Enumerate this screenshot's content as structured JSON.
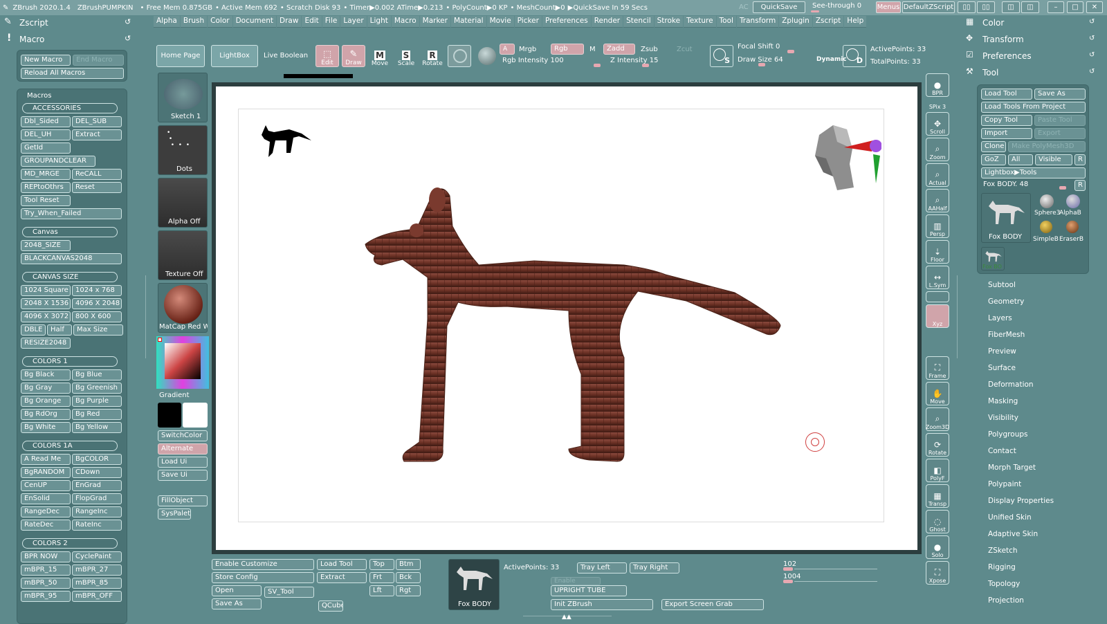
{
  "topbar": {
    "title": "ZBrush 2020.1.4",
    "doc": "ZBrushPUMPKIN",
    "free_mem": "• Free Mem 0.875GB",
    "active_mem": "• Active Mem 692",
    "scratch": "• Scratch Disk 93",
    "timer": "• Timer▶0.002 ATime▶0.213",
    "polycount": "• PolyCount▶0 KP",
    "meshcount": "• MeshCount▶0",
    "quicksave_in": "▶QuickSave In 59 Secs",
    "ac": "AC",
    "quicksave": "QuickSave",
    "seethrough": "See-through  0",
    "menus": "Menus",
    "script": "DefaultZScript"
  },
  "menus": [
    "Alpha",
    "Brush",
    "Color",
    "Document",
    "Draw",
    "Edit",
    "File",
    "Layer",
    "Light",
    "Macro",
    "Marker",
    "Material",
    "Movie",
    "Picker",
    "Preferences",
    "Render",
    "Stencil",
    "Stroke",
    "Texture",
    "Tool",
    "Transform",
    "Zplugin",
    "Zscript",
    "Help"
  ],
  "left": {
    "zscript": "Zscript",
    "macro": "Macro",
    "new_macro": "New Macro",
    "end_macro": "End Macro",
    "reload": "Reload All Macros",
    "macros": "Macros",
    "sections": [
      {
        "title": "ACCESSORIES",
        "rows": [
          [
            "Dbl_Sided",
            "DEL_SUB"
          ],
          [
            "DEL_UH",
            "Extract"
          ],
          [
            "GetId"
          ],
          [
            "GROUPANDCLEAR"
          ],
          [
            "MD_MRGE",
            "ReCALL"
          ],
          [
            "REPtoOthrs",
            "Reset"
          ],
          [
            "Tool Reset"
          ],
          [
            "Try_When_Failed"
          ]
        ]
      },
      {
        "title": "Canvas",
        "rows": [
          [
            "2048_SIZE"
          ],
          [
            "BLACKCANVAS2048"
          ]
        ]
      },
      {
        "title": "CANVAS SIZE",
        "rows": [
          [
            "1024 Square",
            "1024 x 768"
          ],
          [
            "2048 X 1536",
            "4096 X 2048"
          ],
          [
            "4096 X 3072",
            "800 X 600"
          ],
          [
            "DBLE",
            "Half",
            "Max Size"
          ],
          [
            "RESIZE2048"
          ]
        ]
      },
      {
        "title": "COLORS 1",
        "rows": [
          [
            "Bg Black",
            "Bg Blue"
          ],
          [
            "Bg Gray",
            "Bg Greenish"
          ],
          [
            "Bg Orange",
            "Bg Purple"
          ],
          [
            "Bg RdOrg",
            "Bg Red"
          ],
          [
            "Bg White",
            "Bg Yellow"
          ]
        ]
      },
      {
        "title": "COLORS 1A",
        "rows": [
          [
            "A Read Me",
            "BgCOLOR"
          ],
          [
            "BgRANDOM",
            "CDown"
          ],
          [
            "CenUP",
            "EnGrad"
          ],
          [
            "EnSolid",
            "FlopGrad"
          ],
          [
            "RangeDec",
            "RangeInc"
          ],
          [
            "RateDec",
            "RateInc"
          ]
        ]
      },
      {
        "title": "COLORS 2",
        "rows": [
          [
            "BPR NOW",
            "CyclePaint"
          ],
          [
            "mBPR_15",
            "mBPR_27"
          ],
          [
            "mBPR_50",
            "mBPR_85"
          ],
          [
            "mBPR_95",
            "mBPR_OFF"
          ]
        ]
      }
    ]
  },
  "shelf": {
    "home": "Home Page",
    "lightbox": "LightBox",
    "live_boolean": "Live Boolean",
    "edit": "Edit",
    "draw": "Draw",
    "move": "Move",
    "scale": "Scale",
    "rotate": "Rotate",
    "a": "A",
    "mrgb": "Mrgb",
    "rgb": "Rgb",
    "m": "M",
    "zadd": "Zadd",
    "zsub": "Zsub",
    "zcut": "Zcut",
    "rgb_intensity": "Rgb Intensity 100",
    "z_intensity": "Z Intensity 15",
    "focal_shift": "Focal Shift 0",
    "draw_size": "Draw Size 64",
    "dynamic": "Dynamic",
    "active_points": "ActivePoints: 33",
    "total_points": "TotalPoints: 33"
  },
  "brushes": {
    "stroke": "Sketch 1",
    "dots": "Dots",
    "alpha": "Alpha Off",
    "texture": "Texture Off",
    "material": "MatCap Red Wa",
    "gradient": "Gradient",
    "switch_color": "SwitchColor",
    "alternate": "Alternate",
    "load_ui": "Load Ui",
    "save_ui": "Save Ui",
    "fill_object": "FillObject",
    "sys_palette": "SysPalett"
  },
  "right_tools": [
    "BPR",
    "SPix 3",
    "Scroll",
    "Zoom",
    "Actual",
    "AAHalf",
    "Persp",
    "Floor",
    "L.Sym",
    "",
    "Xyz",
    "",
    "",
    "Frame",
    "Move",
    "Zoom3D",
    "Rotate",
    "PolyF",
    "Transp",
    "Ghost",
    "Solo",
    "Xpose"
  ],
  "tool_panel": {
    "color": "Color",
    "transform": "Transform",
    "preferences": "Preferences",
    "tool": "Tool",
    "load_tool": "Load Tool",
    "save_as": "Save As",
    "load_project": "Load Tools From Project",
    "copy_tool": "Copy Tool",
    "paste_tool": "Paste Tool",
    "import": "Import",
    "export": "Export",
    "clone": "Clone",
    "make_polymesh": "Make PolyMesh3D",
    "goz": "GoZ",
    "all": "All",
    "visible": "Visible",
    "r": "R",
    "lightbox_tools": "Lightbox▶Tools",
    "current_tool": "Fox BODY. 48",
    "thumbs": [
      "Fox BODY",
      "Sphere3",
      "AlphaB",
      "SimpleB",
      "EraserB"
    ],
    "small_thumb": "Fox BO",
    "sub_menu": [
      "Subtool",
      "Geometry",
      "Layers",
      "FiberMesh",
      "Preview",
      "Surface",
      "Deformation",
      "Masking",
      "Visibility",
      "Polygroups",
      "Contact",
      "Morph Target",
      "Polypaint",
      "Display Properties",
      "Unified Skin",
      "Adaptive Skin",
      "ZSketch",
      "Rigging",
      "Topology",
      "Projection"
    ]
  },
  "bottom": {
    "enable_customize": "Enable Customize",
    "store_config": "Store Config",
    "open": "Open",
    "save_as": "Save As",
    "sv_tool": "SV_Tool",
    "load_tool": "Load Tool",
    "extract": "Extract",
    "qcube": "QCube",
    "top": "Top",
    "btm": "Btm",
    "frt": "Frt",
    "bck": "Bck",
    "lft": "Lft",
    "rgt": "Rgt",
    "tool_name": "Fox BODY",
    "active_points": "ActivePoints: 33",
    "tray_left": "Tray Left",
    "tray_right": "Tray Right",
    "enable": "Enable",
    "upright": "UPRIGHT TUBE",
    "init": "Init ZBrush",
    "export_grab": "Export Screen Grab",
    "val1": "102",
    "val2": "1004"
  }
}
